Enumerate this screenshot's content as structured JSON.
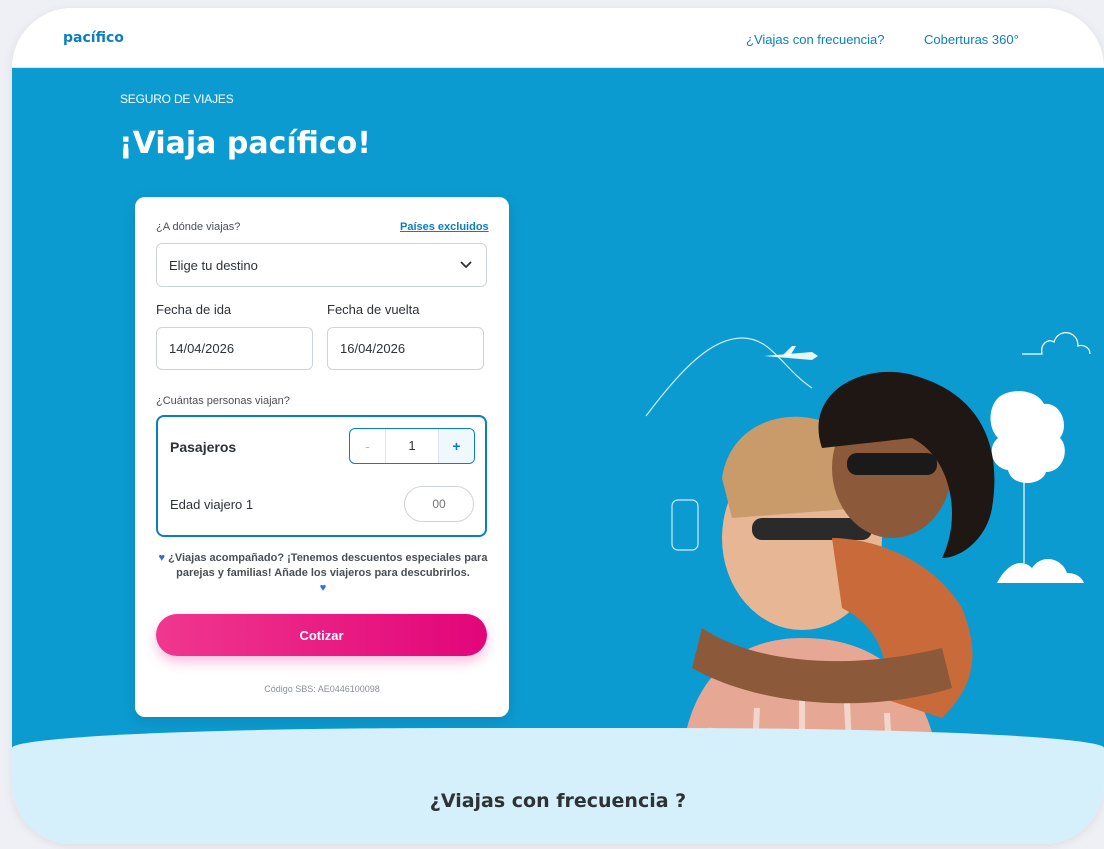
{
  "header": {
    "logo": "pacífico",
    "nav": [
      "¿Viajas con frecuencia?",
      "Coberturas 360°"
    ]
  },
  "hero": {
    "eyebrow": "SEGURO DE VIAJES",
    "title": "¡Viaja pacífico!"
  },
  "form": {
    "destination_question": "¿A dónde viajas?",
    "excluded_link": "Países excluidos",
    "destination_placeholder": "Elige tu destino",
    "departure_label": "Fecha de ida",
    "departure_value": "14/04/2026",
    "return_label": "Fecha de vuelta",
    "return_value": "16/04/2026",
    "people_question": "¿Cuántas personas viajan?",
    "passengers_label": "Pasajeros",
    "passengers_count": "1",
    "minus": "-",
    "plus": "+",
    "traveler_age_label": "Edad viajero 1",
    "traveler_age_placeholder": "00",
    "promo_text": "¿Viajas acompañado? ¡Tenemos descuentos especiales para parejas y familias! Añade los viajeros para descubrirlos.",
    "quote_button": "Cotizar",
    "sbs_code": "Código SBS: AE0446100098"
  },
  "section": {
    "title": "¿Viajas con frecuencia ?"
  },
  "colors": {
    "brand_blue": "#0c9bd1",
    "link_blue": "#0a7fc0",
    "cta_pink": "#e2057a",
    "light_band": "#d5f0fa"
  },
  "icons": [
    "chevron-down-icon",
    "heart-icon",
    "airplane-icon",
    "cloud-icon",
    "tree-icon"
  ]
}
